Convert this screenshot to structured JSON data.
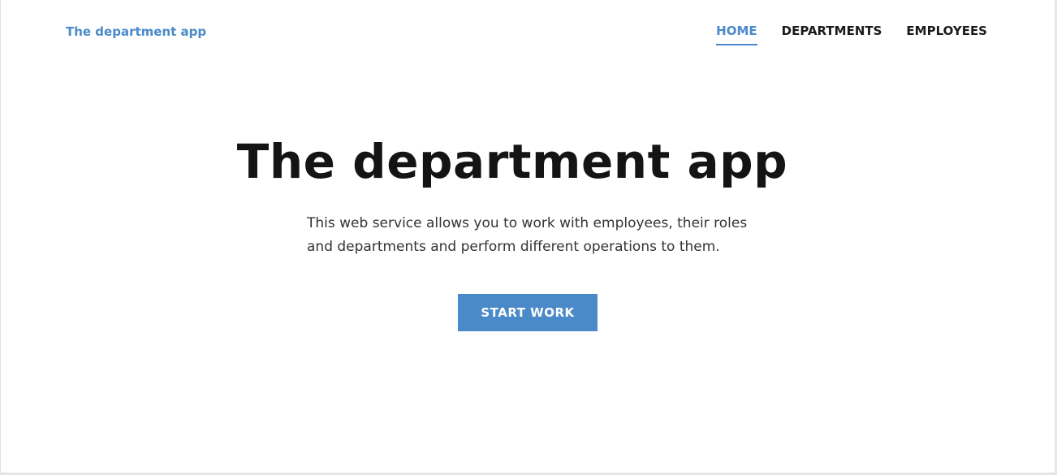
{
  "header": {
    "brand": "The department app",
    "nav": [
      {
        "label": "HOME",
        "active": true
      },
      {
        "label": "DEPARTMENTS",
        "active": false
      },
      {
        "label": "EMPLOYEES",
        "active": false
      }
    ]
  },
  "hero": {
    "title": "The department app",
    "description": "This web service allows you to work with employees, their roles and departments and perform different operations to them.",
    "cta_label": "START WORK"
  },
  "colors": {
    "accent": "#4a8ac9",
    "text": "#141414",
    "background": "#ffffff"
  }
}
